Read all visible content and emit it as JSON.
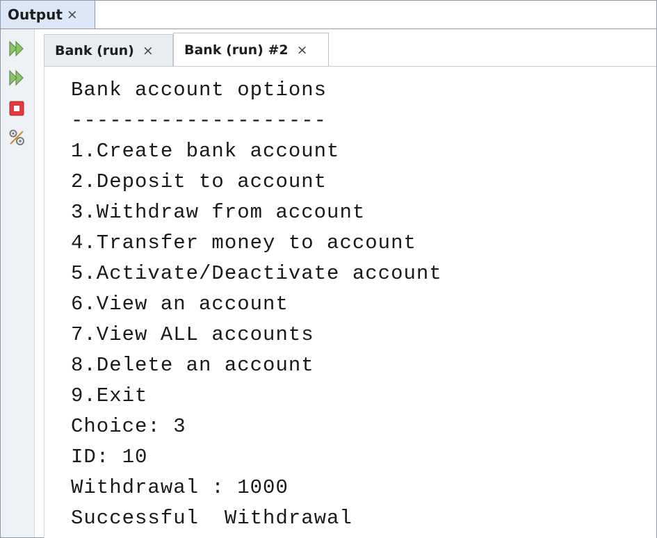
{
  "window": {
    "output_tab": {
      "label": "Output",
      "close": "×"
    }
  },
  "toolbar": {
    "icons": [
      "rerun-icon",
      "rerun-with-options-icon",
      "stop-icon",
      "settings-icon"
    ]
  },
  "run_tabs": [
    {
      "label": "Bank (run)",
      "close": "×",
      "active": false
    },
    {
      "label": "Bank (run) #2",
      "close": "×",
      "active": true
    }
  ],
  "console": {
    "lines": [
      "Bank account options",
      "--------------------",
      "1.Create bank account",
      "2.Deposit to account",
      "3.Withdraw from account",
      "4.Transfer money to account",
      "5.Activate/Deactivate account",
      "6.View an account",
      "7.View ALL accounts",
      "8.Delete an account",
      "9.Exit",
      "Choice: 3",
      "ID: 10",
      "Withdrawal : 1000",
      "Successful  Withdrawal"
    ]
  },
  "colors": {
    "output_tab_bg": "#dce8f6",
    "run_icon_green": "#6aa84f",
    "stop_red": "#e0393e"
  }
}
